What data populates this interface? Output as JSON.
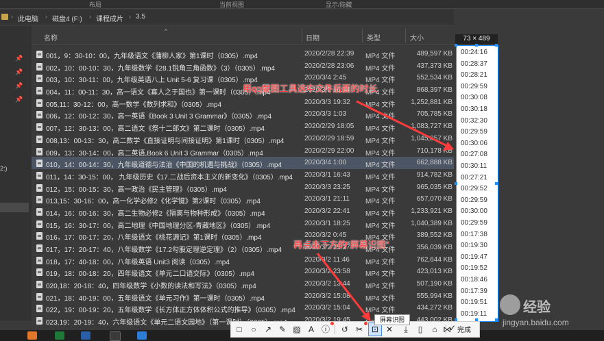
{
  "ribbon": {
    "labels": [
      "布局",
      "当前视图",
      "显示/隐藏"
    ]
  },
  "address": {
    "crumbs": [
      "此电脑",
      "磁盘4 (F:)",
      "课程成片",
      "3.5"
    ]
  },
  "nav": {
    "partial_label": "2:)"
  },
  "header": {
    "name": "名称",
    "date": "日期",
    "type": "类型",
    "size": "大小"
  },
  "files": [
    {
      "name": "001，9：30-10：00，九年级语文《蒲柳人家》第1课时（0305）.mp4",
      "date": "2020/2/28 22:39",
      "type": "MP4 文件",
      "size": "489,597 KB"
    },
    {
      "name": "002，10：00-10：30，九年级数学《28.1锐角三角函数》（3）（0305）.mp4",
      "date": "2020/2/28 23:06",
      "type": "MP4 文件",
      "size": "437,373 KB"
    },
    {
      "name": "003，10：30-11：00，九年级英语八上 Unit 5-6  复习课（0305）.mp4",
      "date": "2020/3/4 2:45",
      "type": "MP4 文件",
      "size": "552,534 KB"
    },
    {
      "name": "004，11：00-11：30，高一语文《寡人之于国也》第一课时（0305）.mp4",
      "date": "2020/3/2 16:34",
      "type": "MP4 文件",
      "size": "868,397 KB"
    },
    {
      "name": "005,11：30-12：00，高一数学《数列求和》（0305）.mp4",
      "date": "2020/3/3 19:32",
      "type": "MP4 文件",
      "size": "1,252,881 KB"
    },
    {
      "name": "006，12：00-12：30，高一英语《Book 3 Unit 3 Grammar》（0305）.mp4",
      "date": "2020/3/3 1:03",
      "type": "MP4 文件",
      "size": "705,785 KB"
    },
    {
      "name": "007，12：30-13：00，高二语文《祭十二郎文》第二课时（0305）.mp4",
      "date": "2020/2/29 18:05",
      "type": "MP4 文件",
      "size": "1,083,727 KB"
    },
    {
      "name": "008,13：00-13：30，高二数学《直接证明与间接证明》第1课时（0305）.mp4",
      "date": "2020/2/29 18:59",
      "type": "MP4 文件",
      "size": "1,045,857 KB"
    },
    {
      "name": "009，13：30-14：00，高二英语,Book 6 Unit 3 Grammar（0305）.mp4",
      "date": "2020/2/29 22:00",
      "type": "MP4 文件",
      "size": "710,178 KB"
    },
    {
      "name": "010，14：00-14：30，九年级道德与法治《中国的机遇与挑战》（0305）.mp4",
      "date": "2020/3/4 1:00",
      "type": "MP4 文件",
      "size": "662,888 KB"
    },
    {
      "name": "011，14：30-15：00， 九年级历史《17.二战后资本主义的新变化》（0305）.mp4",
      "date": "2020/3/1 16:43",
      "type": "MP4 文件",
      "size": "914,782 KB"
    },
    {
      "name": "012，15：00-15：30，高一政治《民主管理》（0305）.mp4",
      "date": "2020/3/3 23:25",
      "type": "MP4 文件",
      "size": "965,035 KB"
    },
    {
      "name": "013,15：30-16：00，高一化学必修2《化学键》第2课时（0305）.mp4",
      "date": "2020/3/1 21:11",
      "type": "MP4 文件",
      "size": "657,070 KB"
    },
    {
      "name": "014，16：00-16：30，高二生物必修2《隔离与物种形成》（0305）.mp4",
      "date": "2020/3/2 22:41",
      "type": "MP4 文件",
      "size": "1,233,921 KB"
    },
    {
      "name": "015，16：30-17：00，高二地理《中国地理分区-青藏地区》（0305）.mp4",
      "date": "2020/3/1 18:25",
      "type": "MP4 文件",
      "size": "1,040,389 KB"
    },
    {
      "name": "016，17：00-17：20，八年级语文《桃花源记》第1课时（0305）.mp4",
      "date": "2020/3/2 0:45",
      "type": "MP4 文件",
      "size": "389,552 KB"
    },
    {
      "name": "017，17：20-17：40，八年级数学《17.2勾股定理逆定理》（2）（0305）.mp4",
      "date": "2020/3/2 15:27",
      "type": "MP4 文件",
      "size": "356,039 KB"
    },
    {
      "name": "018，17：40-18：00，八年级英语 Unit3 阅读（0305）.mp4",
      "date": "2020/3/2 11:46",
      "type": "MP4 文件",
      "size": "762,644 KB"
    },
    {
      "name": "019，18：00-18：20，四年级语文《单元二口语交际》（0305）.mp4",
      "date": "2020/3/2 23:58",
      "type": "MP4 文件",
      "size": "423,013 KB"
    },
    {
      "name": "020,18：20-18：40，四年级数学《小数的读法和写法》（0305）.mp4",
      "date": "2020/3/2 13:44",
      "type": "MP4 文件",
      "size": "507,190 KB"
    },
    {
      "name": "021，18：40-19：00，五年级语文《单元习作》第一课时（0305）.mp4",
      "date": "2020/3/2 15:08",
      "type": "MP4 文件",
      "size": "555,994 KB"
    },
    {
      "name": "022，19：00-19：20，五年级数学《长方体正方体体积公式的推导》（0305）.mp4",
      "date": "2020/3/2 15:04",
      "type": "MP4 文件",
      "size": "434,272 KB"
    },
    {
      "name": "023,19：20-19：40，六年级语文《单元二语文园地》（第一课时）（0305）.mp4",
      "date": "2020/3/2 19:45",
      "type": "MP4 文件",
      "size": "443,002 KB"
    }
  ],
  "selected_row": 9,
  "capture": {
    "dimensions": "73 × 489",
    "durations": [
      "00:24:16",
      "00:28:37",
      "00:28:21",
      "00:29:59",
      "00:30:08",
      "00:30:18",
      "00:32:30",
      "00:29:59",
      "00:30:06",
      "00:27:08",
      "00:30:11",
      "00:27:21",
      "00:29:52",
      "00:29:59",
      "00:30:00",
      "00:29:59",
      "00:17:38",
      "00:19:30",
      "00:19:47",
      "00:19:52",
      "00:18:46",
      "00:17:39",
      "00:19:51",
      "00:19:11"
    ]
  },
  "annotations": {
    "note1": "用qq截图工具选中文件后面的时长",
    "note2": "再点击下方的\"屏幕识图\""
  },
  "toolbar": {
    "tooltip": "屏幕识图",
    "done_label": "完成",
    "tools": [
      "rectangle-tool",
      "ellipse-tool",
      "arrow-tool",
      "pen-tool",
      "mosaic-tool",
      "text-tool",
      "bubble-tool",
      "undo-tool",
      "scissors-tool",
      "screen-ocr-tool",
      "pin-tool",
      "download-tool",
      "phone-tool",
      "bookmark-tool",
      "share-tool",
      "close-tool"
    ]
  },
  "watermark": {
    "brand": "经验",
    "url": "jingyan.baidu.com"
  },
  "colors": {
    "annotation_red": "#ff3b3b",
    "selection_blue": "#1e90ff"
  }
}
